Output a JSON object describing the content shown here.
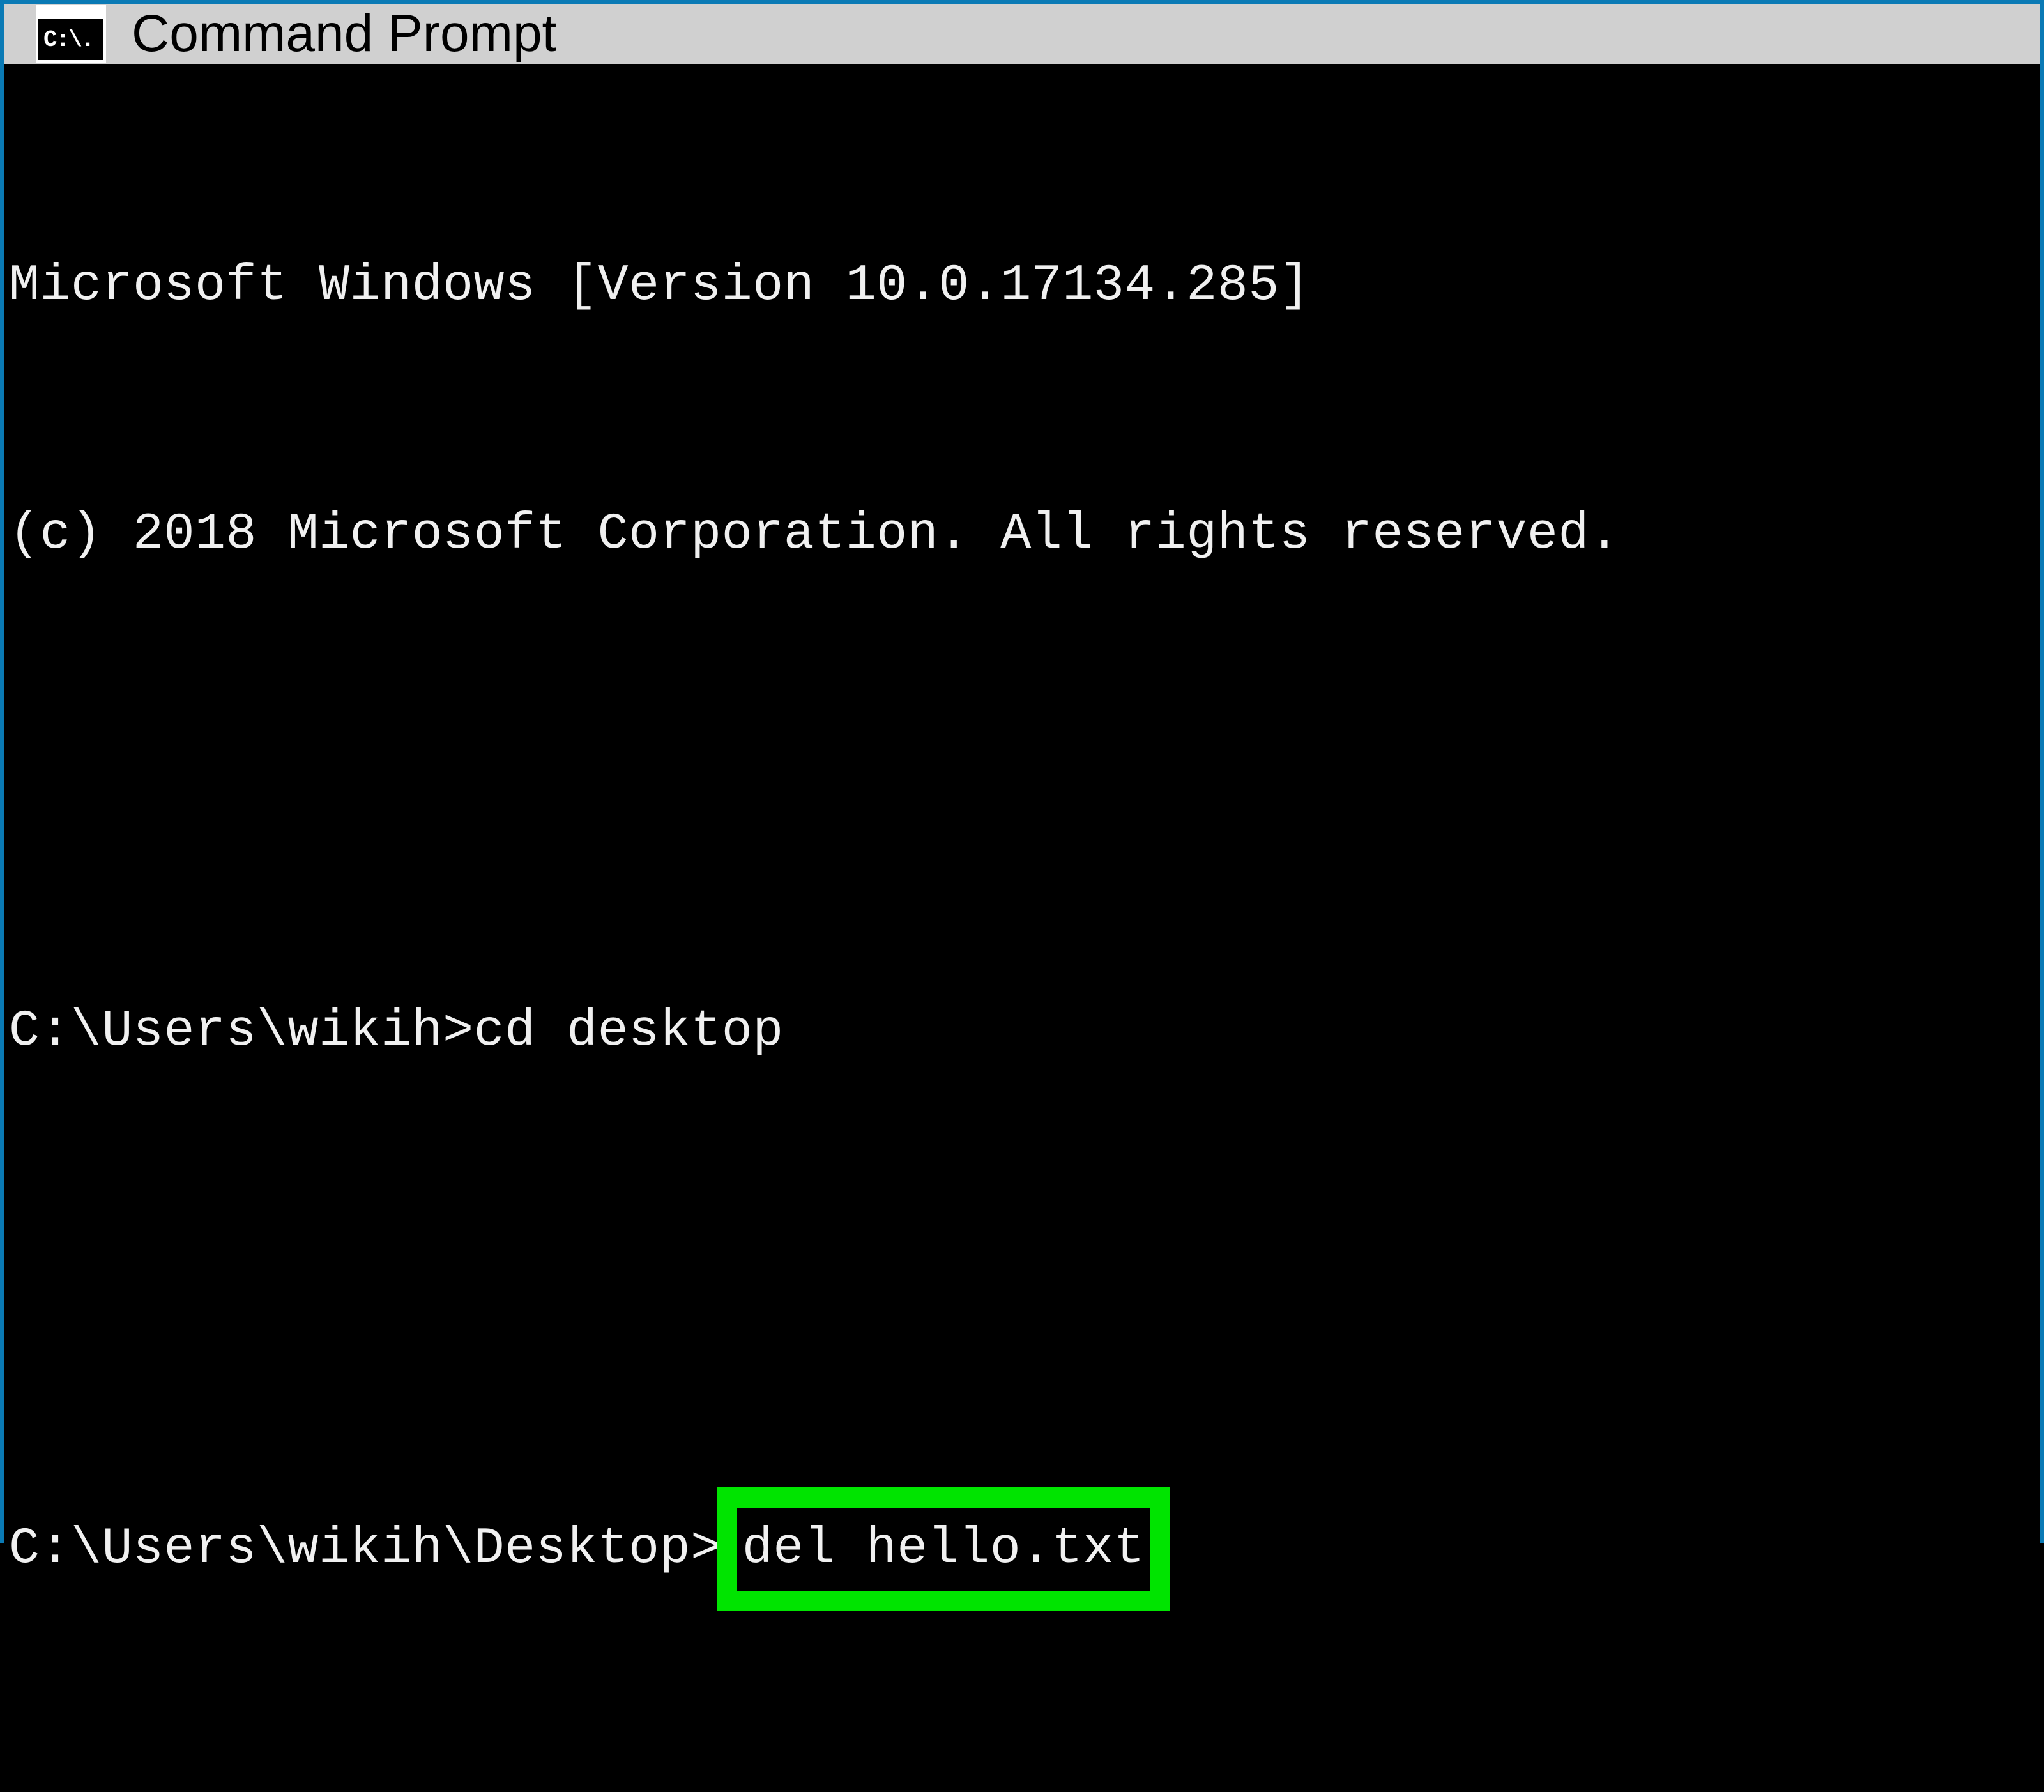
{
  "window": {
    "title": "Command Prompt",
    "icon_label": "C:\\."
  },
  "terminal": {
    "line1": "Microsoft Windows [Version 10.0.17134.285]",
    "line2": "(c) 2018 Microsoft Corporation. All rights reserved.",
    "prompt1": "C:\\Users\\wikih>",
    "command1": "cd desktop",
    "prompt2": "C:\\Users\\wikih\\Desktop>",
    "command2": "del hello.txt"
  },
  "highlight": {
    "color": "#00e400"
  }
}
